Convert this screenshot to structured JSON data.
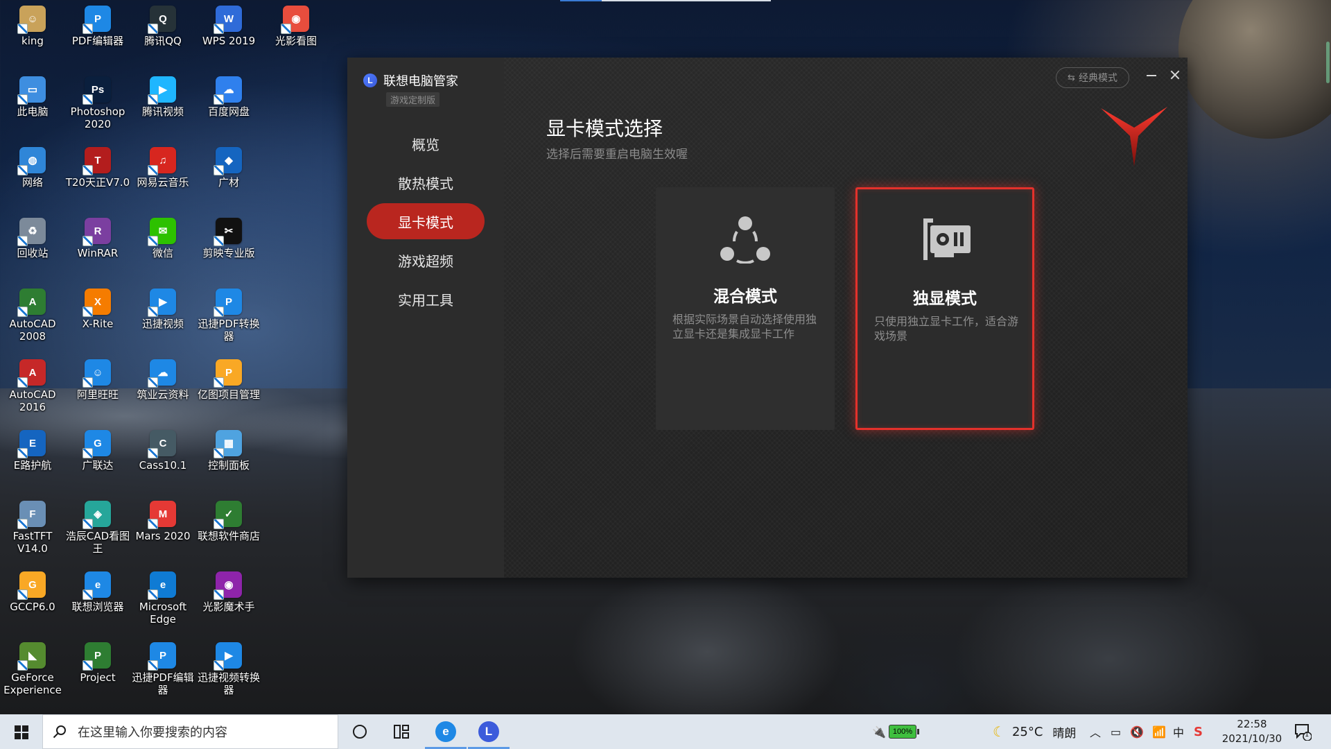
{
  "desktop": {
    "icons": [
      {
        "label": "king",
        "glyph": "☺",
        "color": "#c9a25a"
      },
      {
        "label": "PDF编辑器",
        "glyph": "P",
        "color": "#1e88e5"
      },
      {
        "label": "腾讯QQ",
        "glyph": "Q",
        "color": "#263238"
      },
      {
        "label": "WPS 2019",
        "glyph": "W",
        "color": "#2f6bd8"
      },
      {
        "label": "光影看图",
        "glyph": "◉",
        "color": "#e84d3d"
      },
      {
        "label": "此电脑",
        "glyph": "▭",
        "color": "#3e8ee0"
      },
      {
        "label": "Photoshop 2020",
        "glyph": "Ps",
        "color": "#0a1f3d"
      },
      {
        "label": "腾讯视频",
        "glyph": "▶",
        "color": "#1fb6ff"
      },
      {
        "label": "百度网盘",
        "glyph": "☁",
        "color": "#2f80ed"
      },
      {
        "label": "网络",
        "glyph": "◍",
        "color": "#2f86d8"
      },
      {
        "label": "T20天正V7.0",
        "glyph": "T",
        "color": "#b31d1d"
      },
      {
        "label": "网易云音乐",
        "glyph": "♫",
        "color": "#d7261f"
      },
      {
        "label": "广材",
        "glyph": "◆",
        "color": "#1565c0"
      },
      {
        "label": "回收站",
        "glyph": "♻",
        "color": "#7c8a9a"
      },
      {
        "label": "WinRAR",
        "glyph": "R",
        "color": "#7b3fa0"
      },
      {
        "label": "微信",
        "glyph": "✉",
        "color": "#2dc100"
      },
      {
        "label": "剪映专业版",
        "glyph": "✂",
        "color": "#111111"
      },
      {
        "label": "AutoCAD 2008",
        "glyph": "A",
        "color": "#2e7d32"
      },
      {
        "label": "X-Rite",
        "glyph": "X",
        "color": "#f57c00"
      },
      {
        "label": "迅捷视频",
        "glyph": "▶",
        "color": "#1e88e5"
      },
      {
        "label": "迅捷PDF转换器",
        "glyph": "P",
        "color": "#1e88e5"
      },
      {
        "label": "AutoCAD 2016",
        "glyph": "A",
        "color": "#c62828"
      },
      {
        "label": "阿里旺旺",
        "glyph": "☺",
        "color": "#1e88e5"
      },
      {
        "label": "筑业云资料",
        "glyph": "☁",
        "color": "#1e88e5"
      },
      {
        "label": "亿图项目管理",
        "glyph": "P",
        "color": "#f9a825"
      },
      {
        "label": "E路护航",
        "glyph": "E",
        "color": "#1565c0"
      },
      {
        "label": "广联达",
        "glyph": "G",
        "color": "#1e88e5"
      },
      {
        "label": "Cass10.1",
        "glyph": "C",
        "color": "#455a64"
      },
      {
        "label": "控制面板",
        "glyph": "▦",
        "color": "#4fa3e0"
      },
      {
        "label": "FastTFT V14.0",
        "glyph": "F",
        "color": "#6a8fb5"
      },
      {
        "label": "浩辰CAD看图王",
        "glyph": "◈",
        "color": "#26a69a"
      },
      {
        "label": "Mars 2020",
        "glyph": "M",
        "color": "#e53935"
      },
      {
        "label": "联想软件商店",
        "glyph": "✓",
        "color": "#2e7d32"
      },
      {
        "label": "GCCP6.0",
        "glyph": "G",
        "color": "#f9a825"
      },
      {
        "label": "联想浏览器",
        "glyph": "e",
        "color": "#1e88e5"
      },
      {
        "label": "Microsoft Edge",
        "glyph": "e",
        "color": "#0f7bd4"
      },
      {
        "label": "光影魔术手",
        "glyph": "◉",
        "color": "#8e24aa"
      },
      {
        "label": "GeForce Experience",
        "glyph": "◣",
        "color": "#558b2f"
      },
      {
        "label": "Project",
        "glyph": "P",
        "color": "#2e7d32"
      },
      {
        "label": "迅捷PDF编辑器",
        "glyph": "P",
        "color": "#1e88e5"
      },
      {
        "label": "迅捷视频转换器",
        "glyph": "▶",
        "color": "#1e88e5"
      }
    ]
  },
  "app": {
    "brand_name": "联想电脑管家",
    "brand_logo_letter": "L",
    "brand_badge": "游戏定制版",
    "nav": [
      {
        "label": "概览",
        "active": false
      },
      {
        "label": "散热模式",
        "active": false
      },
      {
        "label": "显卡模式",
        "active": true
      },
      {
        "label": "游戏超频",
        "active": false
      },
      {
        "label": "实用工具",
        "active": false
      }
    ],
    "classic_mode_label": "经典模式",
    "page_title": "显卡模式选择",
    "page_subtitle": "选择后需要重启电脑生效喔",
    "modes": [
      {
        "title": "混合模式",
        "desc": "根据实际场景自动选择使用独立显卡还是集成显卡工作",
        "icon": "share-nodes-icon",
        "selected": false
      },
      {
        "title": "独显模式",
        "desc": "只使用独立显卡工作，适合游戏场景",
        "icon": "graphics-card-icon",
        "selected": true
      }
    ],
    "accent_color": "#e4312b"
  },
  "taskbar": {
    "search_placeholder": "在这里输入你要搜索的内容",
    "battery": "100%",
    "weather_temp": "25°C",
    "weather_desc": "晴朗",
    "ime": "中",
    "time": "22:58",
    "date": "2021/10/30",
    "notification_count": "1",
    "pinned": [
      {
        "name": "lenovo-browser",
        "glyph": "e",
        "color": "#1e88e5"
      },
      {
        "name": "lenovo-pc-manager",
        "glyph": "L",
        "color": "#3b5bdb"
      }
    ]
  }
}
